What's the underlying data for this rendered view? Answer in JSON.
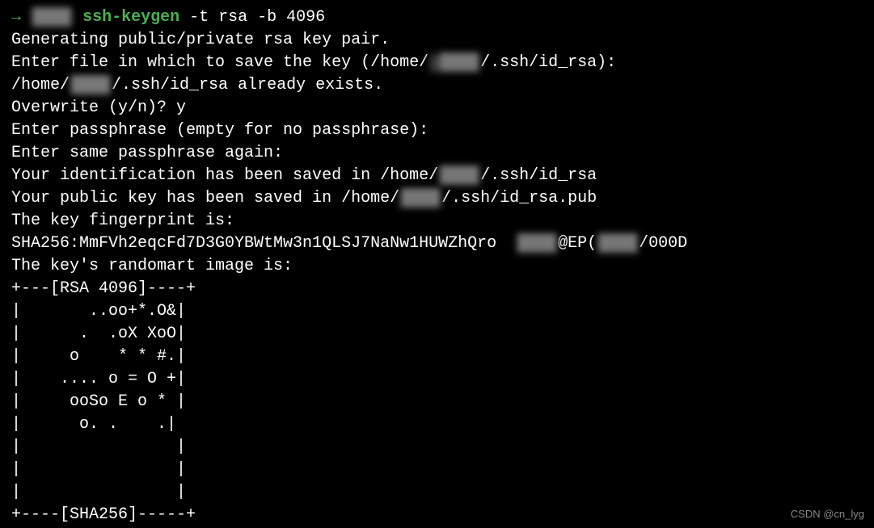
{
  "prompt": {
    "arrow": "→",
    "host_redacted": "████",
    "command": "ssh-keygen",
    "args": " -t rsa -b 4096"
  },
  "lines": {
    "l1": "Generating public/private rsa key pair.",
    "l2_before": "Enter file in which to save the key (/home/",
    "l2_redacted": "g████",
    "l2_after": "/.ssh/id_rsa):",
    "l3_before": "/home/",
    "l3_redacted": "████",
    "l3_after": "/.ssh/id_rsa already exists.",
    "l4": "Overwrite (y/n)? y",
    "l5": "Enter passphrase (empty for no passphrase):",
    "l6": "Enter same passphrase again:",
    "l7_before": "Your identification has been saved in /home/",
    "l7_redacted": "████",
    "l7_after": "/.ssh/id_rsa",
    "l8_before": "Your public key has been saved in /home/",
    "l8_redacted": "████",
    "l8_after": "/.ssh/id_rsa.pub",
    "l9": "The key fingerprint is:",
    "l10_fp": "SHA256:MmFVh2eqcFd7D3G0YBWtMw3n1QLSJ7NaNw1HUWZhQro  ",
    "l10_redacted1": "████",
    "l10_mid": "@EP(",
    "l10_redacted2": "████",
    "l10_end": "/000D",
    "l11": "The key's randomart image is:",
    "art0": "+---[RSA 4096]----+",
    "art1": "|       ..oo+*.O&|",
    "art2": "|      .  .oX XoO|",
    "art3": "|     o    * * #.|",
    "art4": "|    .... o = O +|",
    "art5": "|     ooSo E o * |",
    "art6": "|      o. .    .|",
    "art7": "|                |",
    "art8": "|                |",
    "art9": "|                |",
    "artA": "+----[SHA256]-----+"
  },
  "watermark": "CSDN @cn_lyg"
}
